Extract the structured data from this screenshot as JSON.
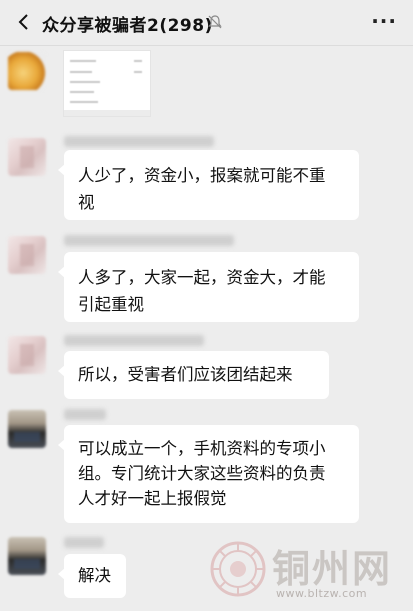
{
  "header": {
    "title": "众分享被骗者2(298)",
    "more_label": "···"
  },
  "messages": [
    {
      "text_lines": [
        "人少了，资金小，报案就可能不重",
        "视"
      ]
    },
    {
      "text_lines": [
        "人多了，大家一起，资金大，才能",
        "引起重视"
      ]
    },
    {
      "text_lines": [
        "所以，受害者们应该团结起来"
      ]
    },
    {
      "text_lines": [
        "可以成立一个，手机资料的专项小",
        "组。专门统计大家这些资料的负责",
        "人才好一起上报假觉"
      ]
    },
    {
      "text_lines": [
        "解决"
      ]
    }
  ],
  "watermark": {
    "brand": "铜州网",
    "url": "www.bltzw.com"
  },
  "icons": {
    "back": "chevron-left-icon",
    "mute": "bell-muted-icon",
    "more": "more-dots-icon"
  }
}
